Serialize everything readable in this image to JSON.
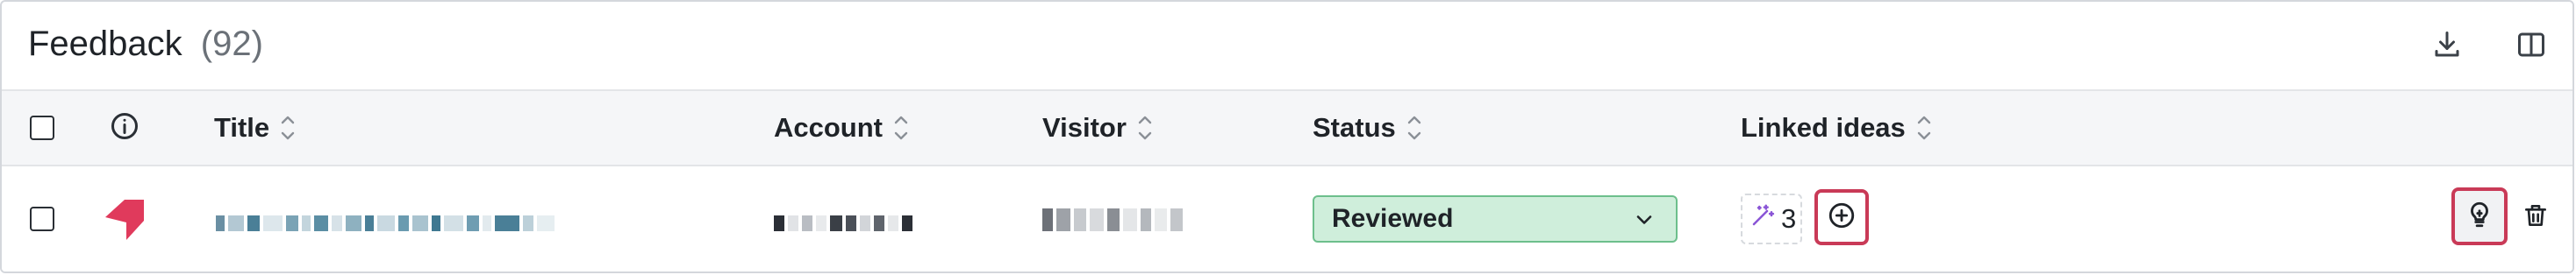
{
  "header": {
    "title": "Feedback",
    "count": "(92)",
    "icons": [
      "download-icon",
      "split-view-icon"
    ]
  },
  "table": {
    "columns": [
      {
        "key": "info",
        "label": ""
      },
      {
        "key": "title",
        "label": "Title"
      },
      {
        "key": "account",
        "label": "Account"
      },
      {
        "key": "visitor",
        "label": "Visitor"
      },
      {
        "key": "status",
        "label": "Status"
      },
      {
        "key": "linked_ideas",
        "label": "Linked ideas"
      }
    ],
    "rows": [
      {
        "status": "Reviewed",
        "linked_ideas_count": "3"
      }
    ]
  },
  "colors": {
    "status_reviewed_bg": "#cfeedb",
    "status_reviewed_border": "#6dbf8c",
    "brand_logo": "#e03a5c",
    "highlight_outline": "#c93a57"
  }
}
